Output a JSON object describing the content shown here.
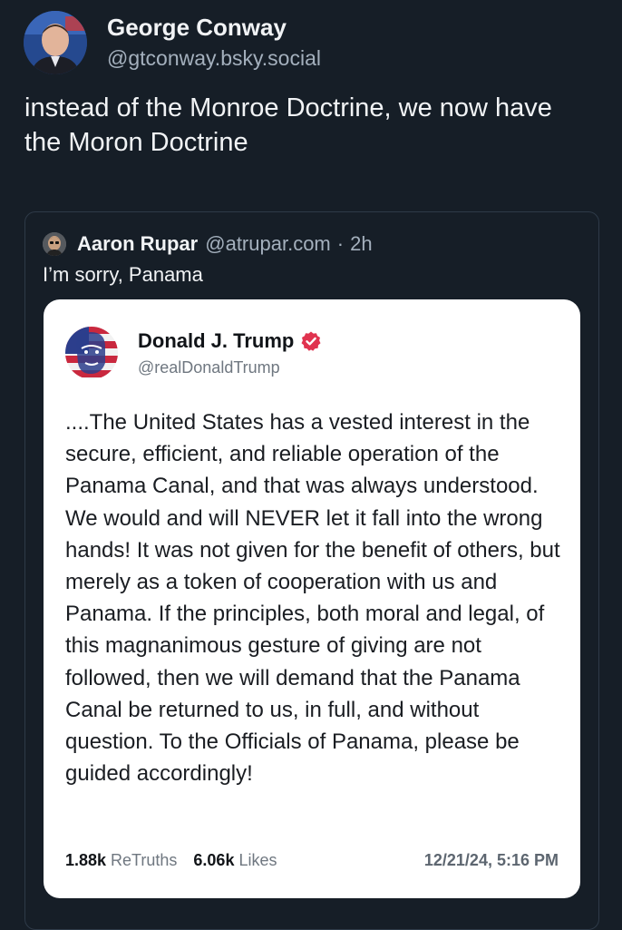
{
  "post": {
    "author_name": "George Conway",
    "author_handle": "@gtconway.bsky.social",
    "text": "instead of the Monroe Doctrine, we now have the Moron Doctrine"
  },
  "quote": {
    "author_name": "Aaron Rupar",
    "author_handle": "@atrupar.com",
    "separator": "·",
    "time": "2h",
    "text": "I’m sorry, Panama"
  },
  "embed": {
    "author_name": "Donald J. Trump",
    "author_handle": "@realDonaldTrump",
    "text": "....The United States has a vested interest in the secure, efficient, and reliable operation of the Panama Canal, and that was always understood. We would and will NEVER let it fall into the wrong hands! It was not given for the benefit of others, but merely as a token of cooperation with us and Panama. If the principles, both moral and legal, of this magnanimous gesture of giving are not followed, then we will demand that the Panama Canal be returned to us, in full, and without question. To the Officials of Panama, please be guided accordingly!",
    "retruths_count": "1.88k",
    "retruths_label": "ReTruths",
    "likes_count": "6.06k",
    "likes_label": "Likes",
    "timestamp": "12/21/24, 5:16 PM"
  },
  "colors": {
    "background": "#161e27",
    "verified_badge": "#e0334f",
    "card": "#ffffff"
  },
  "icons": {
    "verified": "verified-badge-icon"
  }
}
